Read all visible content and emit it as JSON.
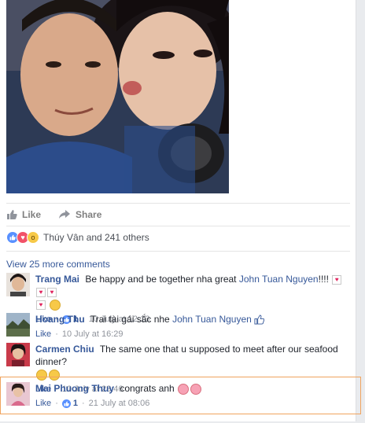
{
  "post": {
    "actions": {
      "like_label": "Like",
      "share_label": "Share"
    },
    "reactions": {
      "summary": "Thúy Vân and 241 others"
    }
  },
  "comments_section": {
    "view_more": "View 25 more comments",
    "comments": [
      {
        "name": "Trang Mai",
        "text": "Be happy and be together nha great",
        "tag": "John Tuan Nguyen",
        "suffix": "!!!!",
        "like_label": "Like",
        "like_count": "1",
        "timestamp": "10 July at 12:13"
      },
      {
        "name": "Hoang Thu",
        "text": "Trai tài gái sắc nhe",
        "tag": "John Tuan Nguyen",
        "like_label": "Like",
        "timestamp": "10 July at 16:29"
      },
      {
        "name": "Carmen Chiu",
        "text": "The same one that u supposed to meet after our seafood dinner?",
        "like_label": "Like",
        "timestamp": "10 July at 23:46"
      },
      {
        "name": "Mai Phuong Thuy",
        "text": "congrats anh",
        "like_label": "Like",
        "like_count": "1",
        "timestamp": "21 July at 08:06"
      }
    ]
  },
  "colors": {
    "link_blue": "#365899",
    "highlight_border": "#f0a35e",
    "like_blue": "#5890ff"
  }
}
